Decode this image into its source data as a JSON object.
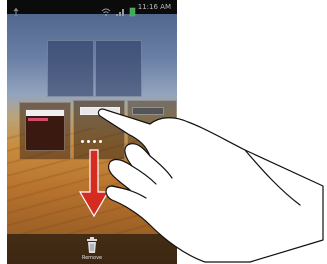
{
  "status_bar": {
    "time": "11:16 AM",
    "icons": [
      "usb-icon",
      "wifi-icon",
      "signal-icon",
      "battery-icon"
    ]
  },
  "bottom_bar": {
    "remove_label": "Remove",
    "icon": "trash-icon"
  },
  "gesture": {
    "arrow": "down-arrow-icon",
    "hand": "pointing-hand-icon"
  },
  "colors": {
    "arrow": "#d62b20",
    "status_bar": "#0b0b0b",
    "sky": "#4a5f86",
    "sand": "#c98e3f"
  }
}
